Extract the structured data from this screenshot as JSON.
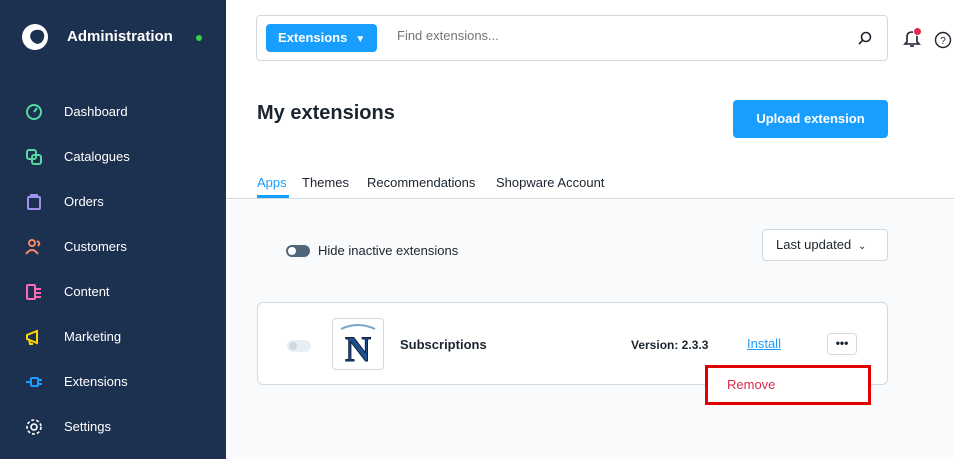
{
  "app": {
    "title": "Administration",
    "status_color": "#37d046"
  },
  "sidebar": {
    "items": [
      {
        "label": "Dashboard",
        "icon": "gauge-icon",
        "color": "#57d9a3"
      },
      {
        "label": "Catalogues",
        "icon": "products-icon",
        "color": "#57d9a3"
      },
      {
        "label": "Orders",
        "icon": "shopping-bag-icon",
        "color": "#a092f0"
      },
      {
        "label": "Customers",
        "icon": "users-icon",
        "color": "#f88962"
      },
      {
        "label": "Content",
        "icon": "content-icon",
        "color": "#ff68b4"
      },
      {
        "label": "Marketing",
        "icon": "megaphone-icon",
        "color": "#ffd700"
      },
      {
        "label": "Extensions",
        "icon": "plug-icon",
        "color": "#189eff"
      },
      {
        "label": "Settings",
        "icon": "gear-icon",
        "color": "#ffffff"
      }
    ]
  },
  "search": {
    "type_label": "Extensions",
    "placeholder": "Find extensions..."
  },
  "page": {
    "title": "My extensions",
    "upload_label": "Upload extension",
    "tabs": [
      "Apps",
      "Themes",
      "Recommendations",
      "Shopware Account"
    ]
  },
  "filters": {
    "hide_inactive_label": "Hide inactive extensions",
    "sort_label": "Last updated"
  },
  "extension": {
    "name": "Subscriptions",
    "version": "Version: 2.3.3",
    "install_label": "Install",
    "more_label": "•••"
  },
  "context_menu": {
    "remove_label": "Remove"
  },
  "colors": {
    "accent": "#189eff",
    "sidebar": "#1c3050",
    "danger": "#de294c"
  }
}
